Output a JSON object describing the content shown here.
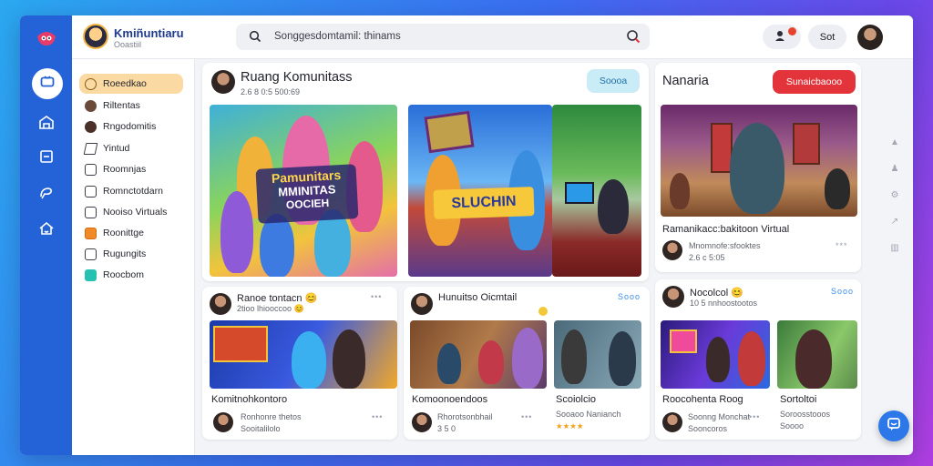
{
  "brand": {
    "title": "Kmiñuntiaru",
    "subtitle": "Ooastiil"
  },
  "search": {
    "text": "Songgesdomtamil: thinams"
  },
  "topbar": {
    "pill_label": "Sot"
  },
  "rail": {
    "icons": [
      "tv-icon",
      "home-icon",
      "document-icon",
      "brush-icon",
      "house-icon"
    ]
  },
  "sidebar": {
    "items": [
      {
        "label": "Roeedkao",
        "icon": "clock-icon"
      },
      {
        "label": "Riltentas",
        "icon": "avatar-icon"
      },
      {
        "label": "Rngodomitis",
        "icon": "avatar-icon"
      },
      {
        "label": "Yintud",
        "icon": "pencil-icon"
      },
      {
        "label": "Roomnjas",
        "icon": "box-icon"
      },
      {
        "label": "Romnctotdarn",
        "icon": "check-icon"
      },
      {
        "label": "Nooiso Virtuals",
        "icon": "box-icon"
      },
      {
        "label": "Roonittge",
        "icon": "flame-icon"
      },
      {
        "label": "Rugungits",
        "icon": "box-icon"
      },
      {
        "label": "Roocbom",
        "icon": "chat-icon"
      }
    ]
  },
  "main": {
    "title": "Ruang Komunitass",
    "subtitle": "2.6 8 0:5 500:69",
    "button": "Soooa",
    "left_image_text": [
      "Pamunitars",
      "MMINITAS",
      "OOCIEH"
    ],
    "center_image_text": "SLUCHIN"
  },
  "right": {
    "title": "Nanaria",
    "button": "Sunaicbaooo",
    "card_title": "Ramanikacc:bakitoon Virtual",
    "author": "Mnomnofe:sfooktes",
    "meta": "2.6 c 5:05",
    "dots": "***"
  },
  "posts": [
    {
      "author": "Ranoe tontacn 😊",
      "sub": "2tioo lhiooccoo 😊",
      "dots": "•••"
    },
    {
      "author": "Hunuitso Oicmtail",
      "sub": "",
      "dots": "Sooo"
    },
    {
      "author": "Nocolcol 😊",
      "sub": "10 5 nnhoostootos",
      "dots": "Sooo"
    }
  ],
  "bottom_cards": [
    {
      "title": "Komitnohkontoro",
      "author": "Ronhonre thetos",
      "meta": "Sooitalilolo",
      "dots": "•••"
    },
    {
      "title": "Komoonoendoos",
      "author": "Rhorotsonbhail",
      "meta": "3 5 0",
      "dots": "•••"
    },
    {
      "title": "Scoiolcio",
      "author": "Sooaoo Nanianch",
      "meta": "★★★★",
      "dots": ""
    },
    {
      "title": "Roocohenta Roog",
      "author": "Soonng Monchat",
      "meta": "Sooncoros",
      "dots": "•••"
    },
    {
      "title": "Sortoltoi",
      "author": "Soroosstooos",
      "meta": "Soooo",
      "dots": ""
    }
  ],
  "colors": {
    "rail": "#2462d8",
    "accent_red": "#e3333b",
    "active_item": "#fbd9a3",
    "mint": "#c9ecf6"
  }
}
